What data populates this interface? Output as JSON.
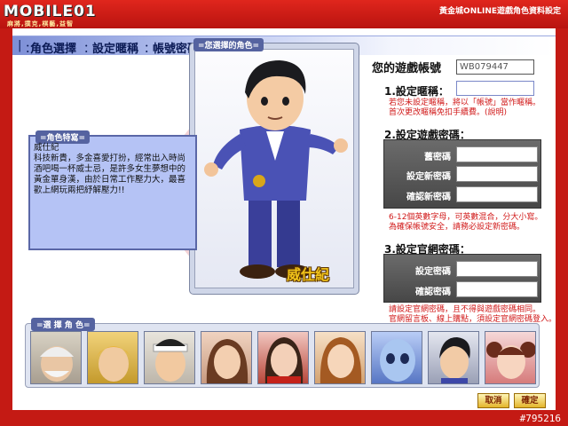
{
  "window": {
    "logo_text": "MOBILE01",
    "logo_tagline": "麻將,撲克,棋藝,益智",
    "title": "黃金城ONLINE遊戲角色資料設定",
    "watermark": "#795216"
  },
  "nav": {
    "items": [
      "角色選擇",
      "設定暱稱",
      "帳號密碼變更"
    ],
    "separator": "："
  },
  "character": {
    "panel_label": "=您選擇的角色=",
    "name": "威仕紀",
    "desc_label": "=角色特寫=",
    "description": "威仕紀\n科技新貴，多金喜愛打扮，經常出入時尚酒吧喝一杯威士忌，是許多女生夢想中的黃金單身漢，由於日常工作壓力大，最喜歡上網玩兩把紓解壓力!!"
  },
  "account": {
    "label": "您的遊戲帳號",
    "value": "WB079447"
  },
  "nickname": {
    "title": "1.設定暱稱：",
    "value": "",
    "note": "若您未設定暱稱，將以「帳號」當作暱稱。\n首次更改暱稱免扣手續費。(說明)"
  },
  "game_password": {
    "title": "2.設定遊戲密碼：",
    "fields": [
      "舊密碼",
      "設定新密碼",
      "確認新密碼"
    ],
    "note": "6-12個英數字母，可英數混合，分大小寫。\n為確保帳號安全，請務必設定新密碼。"
  },
  "site_password": {
    "title": "3.設定官網密碼：",
    "fields": [
      "設定密碼",
      "確認密碼"
    ],
    "note": "請設定官網密碼，且不得與遊戲密碼相同。\n官網留言板、線上購點，須設定官網密碼登入。"
  },
  "selector": {
    "label": "=選 擇 角 色=",
    "characters": [
      "elder-character",
      "blonde-gold-character",
      "headband-character",
      "brown-hair-woman-character",
      "red-dress-woman-character",
      "long-hair-woman-character",
      "alien-character",
      "businessman-character",
      "pigtail-girl-character"
    ]
  },
  "buttons": {
    "cancel": "取消",
    "confirm": "確定"
  },
  "colors": {
    "frame_red": "#c41a14",
    "nav_blue": "#7d8fd6",
    "note_red": "#d11a1a",
    "button_gold": "#e3b52b"
  }
}
